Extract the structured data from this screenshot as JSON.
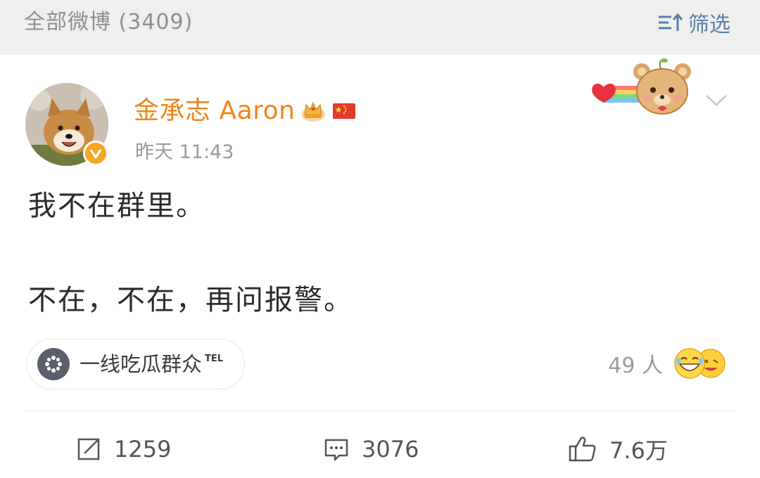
{
  "filter_bar": {
    "title": "全部微博 (3409)",
    "filter_label": "筛选"
  },
  "post": {
    "author": "金承志 Aaron",
    "timestamp": "昨天 11:43",
    "lines": [
      "我不在群里。",
      "不在，不在，再问报警。"
    ],
    "topic": {
      "label": "一线吃瓜群众",
      "tag": "TEL"
    },
    "reactions": {
      "count_text": "49 人"
    },
    "actions": {
      "repost": "1259",
      "comment": "3076",
      "like": "7.6万"
    }
  },
  "colors": {
    "username": "#f08519",
    "filter_accent": "#5a7fa8",
    "verified": "#f6a623",
    "text": "#2b2b2b",
    "muted": "#9b9b9b"
  },
  "icons": {
    "filter": "filter-sort-icon",
    "crown": "crown-badge-icon",
    "flag": "china-flag-icon",
    "verified": "verified-v-icon",
    "chevron": "chevron-down-icon",
    "topic": "topic-dots-icon",
    "repost": "repost-icon",
    "comment": "comment-icon",
    "like": "thumbs-up-icon",
    "decoration": "bear-heart-rainbow-icon",
    "reactions": "laughing-emoji-icon"
  }
}
